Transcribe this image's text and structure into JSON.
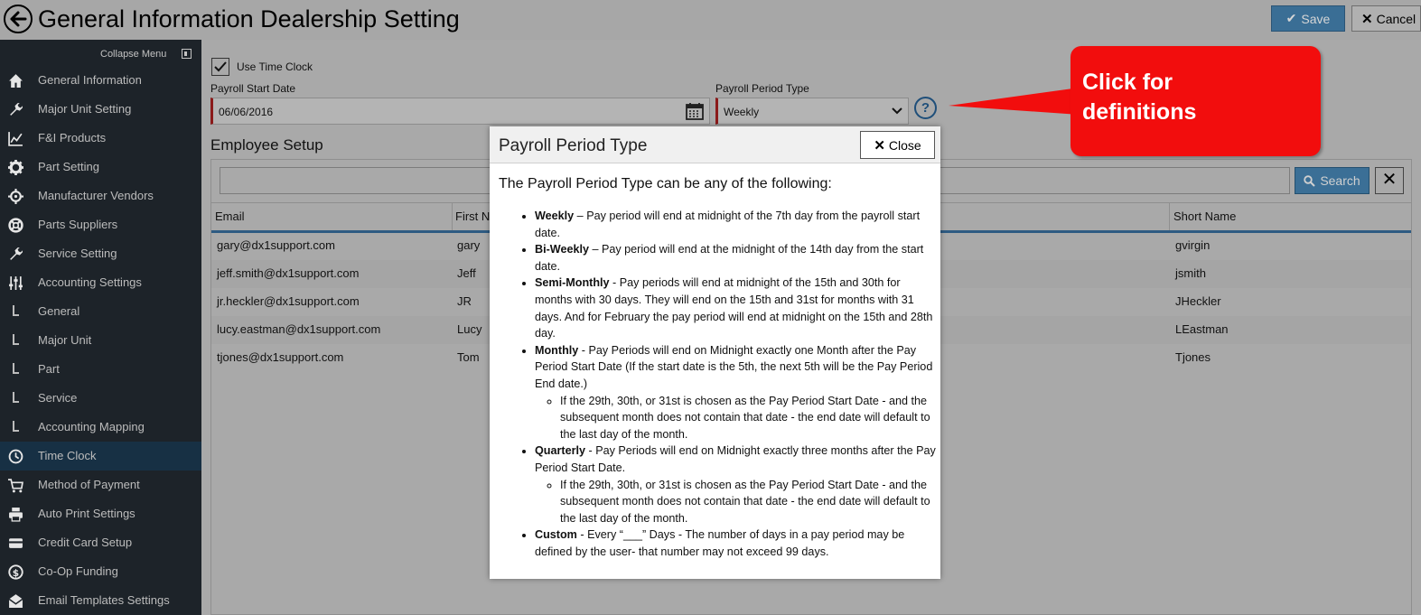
{
  "header": {
    "title": "General Information Dealership Setting",
    "save_label": "Save",
    "cancel_label": "Cancel"
  },
  "sidebar": {
    "collapse_label": "Collapse Menu",
    "items": [
      {
        "label": "General Information",
        "icon": "home-icon"
      },
      {
        "label": "Major Unit Setting",
        "icon": "wrench-icon"
      },
      {
        "label": "F&I Products",
        "icon": "line-chart-icon"
      },
      {
        "label": "Part Setting",
        "icon": "gear-icon"
      },
      {
        "label": "Manufacturer Vendors",
        "icon": "crosshair-icon"
      },
      {
        "label": "Parts Suppliers",
        "icon": "lifebuoy-icon"
      },
      {
        "label": "Service Setting",
        "icon": "wrench-icon"
      },
      {
        "label": "Accounting Settings",
        "icon": "sliders-icon"
      },
      {
        "label": "General",
        "icon": "sub-item-icon"
      },
      {
        "label": "Major Unit",
        "icon": "sub-item-icon"
      },
      {
        "label": "Part",
        "icon": "sub-item-icon"
      },
      {
        "label": "Service",
        "icon": "sub-item-icon"
      },
      {
        "label": "Accounting Mapping",
        "icon": "sub-item-icon"
      },
      {
        "label": "Time Clock",
        "icon": "clock-icon",
        "active": true
      },
      {
        "label": "Method of Payment",
        "icon": "cart-icon"
      },
      {
        "label": "Auto Print Settings",
        "icon": "printer-icon"
      },
      {
        "label": "Credit Card Setup",
        "icon": "credit-card-icon"
      },
      {
        "label": "Co-Op Funding",
        "icon": "dollar-circle-icon"
      },
      {
        "label": "Email Templates Settings",
        "icon": "envelope-icon"
      }
    ]
  },
  "timeclock": {
    "use_label": "Use Time Clock",
    "use_checked": true,
    "start_label": "Payroll Start Date",
    "start_value": "06/06/2016",
    "period_label": "Payroll Period Type",
    "period_value": "Weekly",
    "help_glyph": "?"
  },
  "employee": {
    "heading": "Employee Setup",
    "search_label": "Search",
    "clear_glyph": "✕",
    "columns": [
      "Email",
      "First N",
      "Short Name"
    ],
    "rows": [
      {
        "email": "gary@dx1support.com",
        "first": "gary",
        "short": "gvirgin"
      },
      {
        "email": "jeff.smith@dx1support.com",
        "first": "Jeff",
        "short": "jsmith"
      },
      {
        "email": "jr.heckler@dx1support.com",
        "first": "JR",
        "short": "JHeckler"
      },
      {
        "email": "lucy.eastman@dx1support.com",
        "first": "Lucy",
        "short": "LEastman"
      },
      {
        "email": "tjones@dx1support.com",
        "first": "Tom",
        "short": "Tjones"
      }
    ]
  },
  "callout": {
    "text": "Click for definitions"
  },
  "modal": {
    "title": "Payroll Period Type",
    "close_label": "Close",
    "intro": "The Payroll Period Type can be any of the following:",
    "items": [
      {
        "term": "Weekly",
        "text": " – Pay period will end at midnight of the 7th day from the payroll start date."
      },
      {
        "term": "Bi-Weekly",
        "text": " – Pay period will end at the midnight of the 14th day from the start date."
      },
      {
        "term": "Semi-Monthly",
        "text": " - Pay periods will end at midnight of the 15th and 30th for months with 30 days. They will end on the 15th and 31st for months with 31 days. And for February the pay period will end at midnight on the 15th and 28th day."
      },
      {
        "term": "Monthly",
        "text": " - Pay Periods will end on Midnight exactly one Month after the Pay Period Start Date (If the start date is the 5th, the next 5th will be the Pay Period End date.)",
        "sub": "If the 29th, 30th, or 31st is chosen as the Pay Period Start Date - and the subsequent month does not contain that date - the end date will default to the last day of the month."
      },
      {
        "term": "Quarterly",
        "text": " - Pay Periods will end on Midnight exactly three months after the Pay Period Start Date.",
        "sub": "If the 29th, 30th, or 31st is chosen as the Pay Period Start Date - and the subsequent month does not contain that date - the end date will default to the last day of the month."
      },
      {
        "term": "Custom",
        "text": " - Every “___” Days - The number of days in a pay period may be defined by the user- that number may not exceed 99 days."
      }
    ]
  }
}
